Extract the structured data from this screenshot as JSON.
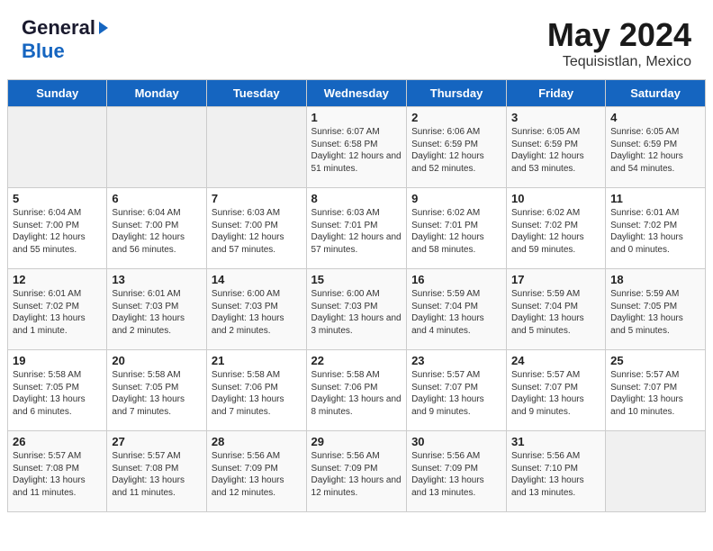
{
  "header": {
    "logo": {
      "general": "General",
      "blue": "Blue"
    },
    "title": "May 2024",
    "location": "Tequisistlan, Mexico"
  },
  "calendar": {
    "days_of_week": [
      "Sunday",
      "Monday",
      "Tuesday",
      "Wednesday",
      "Thursday",
      "Friday",
      "Saturday"
    ],
    "weeks": [
      [
        {
          "day": "",
          "empty": true
        },
        {
          "day": "",
          "empty": true
        },
        {
          "day": "",
          "empty": true
        },
        {
          "day": "1",
          "sunrise": "Sunrise: 6:07 AM",
          "sunset": "Sunset: 6:58 PM",
          "daylight": "Daylight: 12 hours and 51 minutes."
        },
        {
          "day": "2",
          "sunrise": "Sunrise: 6:06 AM",
          "sunset": "Sunset: 6:59 PM",
          "daylight": "Daylight: 12 hours and 52 minutes."
        },
        {
          "day": "3",
          "sunrise": "Sunrise: 6:05 AM",
          "sunset": "Sunset: 6:59 PM",
          "daylight": "Daylight: 12 hours and 53 minutes."
        },
        {
          "day": "4",
          "sunrise": "Sunrise: 6:05 AM",
          "sunset": "Sunset: 6:59 PM",
          "daylight": "Daylight: 12 hours and 54 minutes."
        }
      ],
      [
        {
          "day": "5",
          "sunrise": "Sunrise: 6:04 AM",
          "sunset": "Sunset: 7:00 PM",
          "daylight": "Daylight: 12 hours and 55 minutes."
        },
        {
          "day": "6",
          "sunrise": "Sunrise: 6:04 AM",
          "sunset": "Sunset: 7:00 PM",
          "daylight": "Daylight: 12 hours and 56 minutes."
        },
        {
          "day": "7",
          "sunrise": "Sunrise: 6:03 AM",
          "sunset": "Sunset: 7:00 PM",
          "daylight": "Daylight: 12 hours and 57 minutes."
        },
        {
          "day": "8",
          "sunrise": "Sunrise: 6:03 AM",
          "sunset": "Sunset: 7:01 PM",
          "daylight": "Daylight: 12 hours and 57 minutes."
        },
        {
          "day": "9",
          "sunrise": "Sunrise: 6:02 AM",
          "sunset": "Sunset: 7:01 PM",
          "daylight": "Daylight: 12 hours and 58 minutes."
        },
        {
          "day": "10",
          "sunrise": "Sunrise: 6:02 AM",
          "sunset": "Sunset: 7:02 PM",
          "daylight": "Daylight: 12 hours and 59 minutes."
        },
        {
          "day": "11",
          "sunrise": "Sunrise: 6:01 AM",
          "sunset": "Sunset: 7:02 PM",
          "daylight": "Daylight: 13 hours and 0 minutes."
        }
      ],
      [
        {
          "day": "12",
          "sunrise": "Sunrise: 6:01 AM",
          "sunset": "Sunset: 7:02 PM",
          "daylight": "Daylight: 13 hours and 1 minute."
        },
        {
          "day": "13",
          "sunrise": "Sunrise: 6:01 AM",
          "sunset": "Sunset: 7:03 PM",
          "daylight": "Daylight: 13 hours and 2 minutes."
        },
        {
          "day": "14",
          "sunrise": "Sunrise: 6:00 AM",
          "sunset": "Sunset: 7:03 PM",
          "daylight": "Daylight: 13 hours and 2 minutes."
        },
        {
          "day": "15",
          "sunrise": "Sunrise: 6:00 AM",
          "sunset": "Sunset: 7:03 PM",
          "daylight": "Daylight: 13 hours and 3 minutes."
        },
        {
          "day": "16",
          "sunrise": "Sunrise: 5:59 AM",
          "sunset": "Sunset: 7:04 PM",
          "daylight": "Daylight: 13 hours and 4 minutes."
        },
        {
          "day": "17",
          "sunrise": "Sunrise: 5:59 AM",
          "sunset": "Sunset: 7:04 PM",
          "daylight": "Daylight: 13 hours and 5 minutes."
        },
        {
          "day": "18",
          "sunrise": "Sunrise: 5:59 AM",
          "sunset": "Sunset: 7:05 PM",
          "daylight": "Daylight: 13 hours and 5 minutes."
        }
      ],
      [
        {
          "day": "19",
          "sunrise": "Sunrise: 5:58 AM",
          "sunset": "Sunset: 7:05 PM",
          "daylight": "Daylight: 13 hours and 6 minutes."
        },
        {
          "day": "20",
          "sunrise": "Sunrise: 5:58 AM",
          "sunset": "Sunset: 7:05 PM",
          "daylight": "Daylight: 13 hours and 7 minutes."
        },
        {
          "day": "21",
          "sunrise": "Sunrise: 5:58 AM",
          "sunset": "Sunset: 7:06 PM",
          "daylight": "Daylight: 13 hours and 7 minutes."
        },
        {
          "day": "22",
          "sunrise": "Sunrise: 5:58 AM",
          "sunset": "Sunset: 7:06 PM",
          "daylight": "Daylight: 13 hours and 8 minutes."
        },
        {
          "day": "23",
          "sunrise": "Sunrise: 5:57 AM",
          "sunset": "Sunset: 7:07 PM",
          "daylight": "Daylight: 13 hours and 9 minutes."
        },
        {
          "day": "24",
          "sunrise": "Sunrise: 5:57 AM",
          "sunset": "Sunset: 7:07 PM",
          "daylight": "Daylight: 13 hours and 9 minutes."
        },
        {
          "day": "25",
          "sunrise": "Sunrise: 5:57 AM",
          "sunset": "Sunset: 7:07 PM",
          "daylight": "Daylight: 13 hours and 10 minutes."
        }
      ],
      [
        {
          "day": "26",
          "sunrise": "Sunrise: 5:57 AM",
          "sunset": "Sunset: 7:08 PM",
          "daylight": "Daylight: 13 hours and 11 minutes."
        },
        {
          "day": "27",
          "sunrise": "Sunrise: 5:57 AM",
          "sunset": "Sunset: 7:08 PM",
          "daylight": "Daylight: 13 hours and 11 minutes."
        },
        {
          "day": "28",
          "sunrise": "Sunrise: 5:56 AM",
          "sunset": "Sunset: 7:09 PM",
          "daylight": "Daylight: 13 hours and 12 minutes."
        },
        {
          "day": "29",
          "sunrise": "Sunrise: 5:56 AM",
          "sunset": "Sunset: 7:09 PM",
          "daylight": "Daylight: 13 hours and 12 minutes."
        },
        {
          "day": "30",
          "sunrise": "Sunrise: 5:56 AM",
          "sunset": "Sunset: 7:09 PM",
          "daylight": "Daylight: 13 hours and 13 minutes."
        },
        {
          "day": "31",
          "sunrise": "Sunrise: 5:56 AM",
          "sunset": "Sunset: 7:10 PM",
          "daylight": "Daylight: 13 hours and 13 minutes."
        },
        {
          "day": "",
          "empty": true
        }
      ]
    ]
  }
}
